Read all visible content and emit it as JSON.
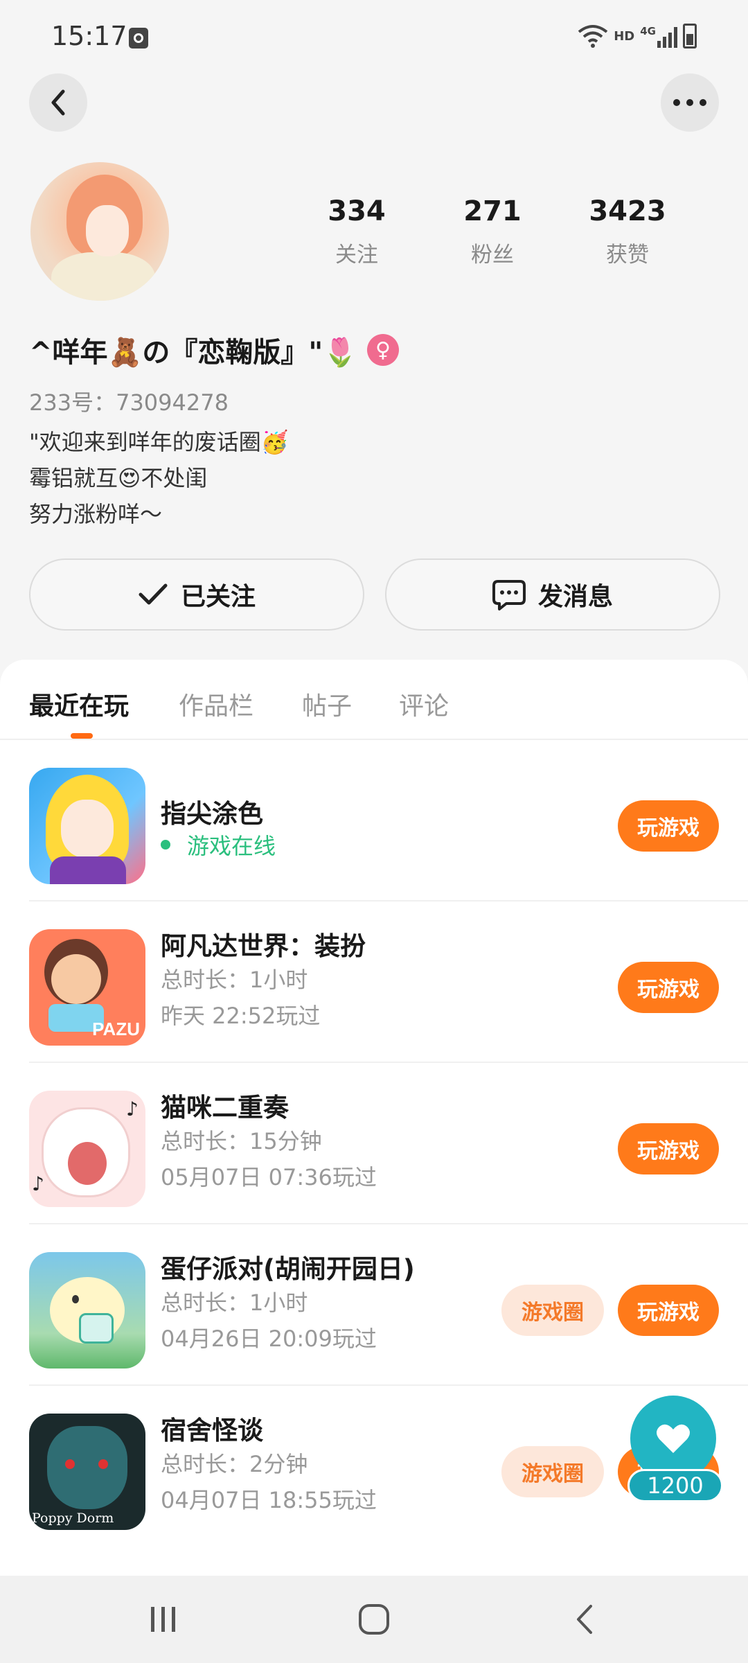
{
  "status_bar": {
    "time": "15:17",
    "network": "HD",
    "signal": "4G",
    "icons": [
      "clock-icon",
      "wifi-icon",
      "signal-icon",
      "battery-icon"
    ]
  },
  "header": {
    "back_icon": "chevron-left-icon",
    "more_icon": "more-dots-icon"
  },
  "profile": {
    "stats": [
      {
        "value": "334",
        "label": "关注"
      },
      {
        "value": "271",
        "label": "粉丝"
      },
      {
        "value": "3423",
        "label": "获赞"
      }
    ],
    "nickname": "^咩年🧸の『恋鞠版』\"🌷",
    "gender_symbol": "♀",
    "gender_color": "#f06b8f",
    "user_id": "233号：73094278",
    "bio_lines": [
      "\"欢迎来到咩年的废话圈🥳",
      "霉铝就互😍不处闺",
      "努力涨粉咩～"
    ],
    "follow_button": "已关注",
    "message_button": "发消息"
  },
  "tabs": [
    {
      "label": "最近在玩",
      "active": true
    },
    {
      "label": "作品栏",
      "active": false
    },
    {
      "label": "帖子",
      "active": false
    },
    {
      "label": "评论",
      "active": false
    }
  ],
  "games": [
    {
      "title": "指尖涂色",
      "status": "游戏在线",
      "play_label": "玩游戏"
    },
    {
      "title": "阿凡达世界：装扮",
      "duration": "总时长：1小时",
      "last_played": "昨天 22:52玩过",
      "play_label": "玩游戏",
      "icon_text": "PAZU"
    },
    {
      "title": "猫咪二重奏",
      "duration": "总时长：15分钟",
      "last_played": "05月07日 07:36玩过",
      "play_label": "玩游戏"
    },
    {
      "title": "蛋仔派对(胡闹开园日)",
      "duration": "总时长：1小时",
      "last_played": "04月26日 20:09玩过",
      "circle_label": "游戏圈",
      "play_label": "玩游戏"
    },
    {
      "title": "宿舍怪谈",
      "duration": "总时长：2分钟",
      "last_played": "04月07日 18:55玩过",
      "circle_label": "游戏圈",
      "play_label": "玩游戏",
      "icon_text": "Poppy Dorm"
    }
  ],
  "like_fab": {
    "count": "1200",
    "icon": "heart-icon"
  },
  "colors": {
    "accent": "#ff7a1a",
    "online": "#2bbf7e",
    "circle_bg": "#fde7da",
    "fab": "#22b5c3"
  }
}
